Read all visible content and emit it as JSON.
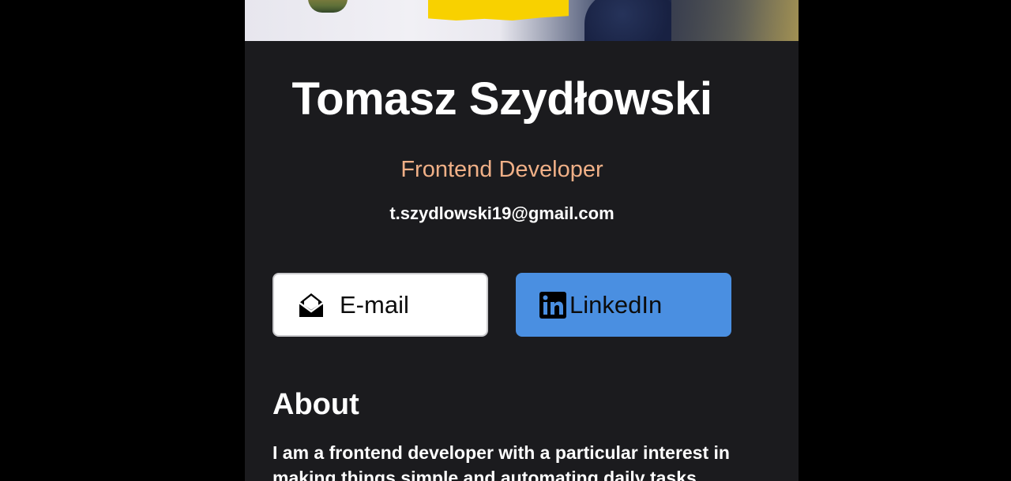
{
  "profile": {
    "name": "Tomasz Szydłowski",
    "role": "Frontend Developer",
    "email": "t.szydlowski19@gmail.com"
  },
  "buttons": {
    "email_label": "E-mail",
    "email_icon": "envelope-open-icon",
    "linkedin_label": "LinkedIn",
    "linkedin_icon": "linkedin-icon"
  },
  "about": {
    "title": "About",
    "text": "I am a frontend developer with a particular interest in making things simple and automating daily tasks"
  },
  "colors": {
    "background": "#000000",
    "card": "#1b1b1e",
    "role": "#f0b087",
    "linkedin_button": "#4a8fe1",
    "email_button": "#ffffff"
  }
}
